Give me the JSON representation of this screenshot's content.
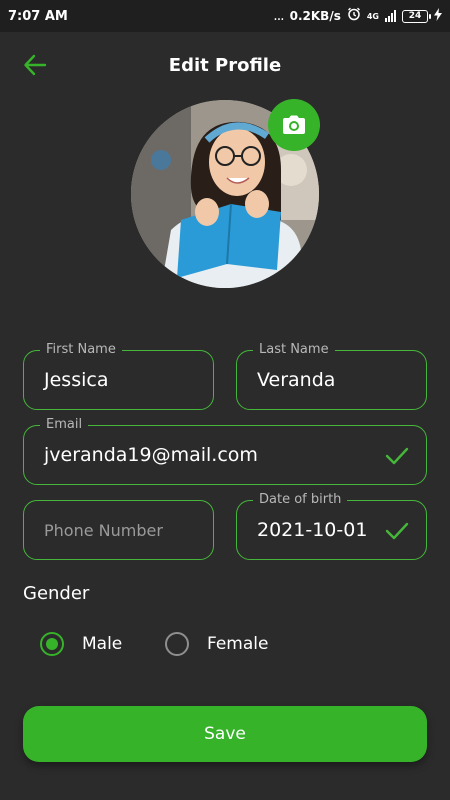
{
  "status_bar": {
    "time": "7:07 AM",
    "dots": "...",
    "net_speed": "0.2KB/s",
    "network": "4G",
    "battery": "24"
  },
  "header": {
    "title": "Edit Profile"
  },
  "form": {
    "first_name": {
      "label": "First Name",
      "value": "Jessica"
    },
    "last_name": {
      "label": "Last Name",
      "value": "Veranda"
    },
    "email": {
      "label": "Email",
      "value": "jveranda19@mail.com"
    },
    "phone": {
      "placeholder": "Phone Number"
    },
    "dob": {
      "label": "Date of birth",
      "value": "2021-10-01"
    }
  },
  "gender": {
    "label": "Gender",
    "options": [
      {
        "label": "Male",
        "selected": true
      },
      {
        "label": "Female",
        "selected": false
      }
    ]
  },
  "actions": {
    "save_label": "Save"
  },
  "colors": {
    "accent": "#37b32a",
    "background": "#2b2b2b",
    "field_border": "#45b63a"
  },
  "icons": {
    "back": "arrow-left-icon",
    "camera": "camera-icon",
    "check": "check-icon"
  }
}
